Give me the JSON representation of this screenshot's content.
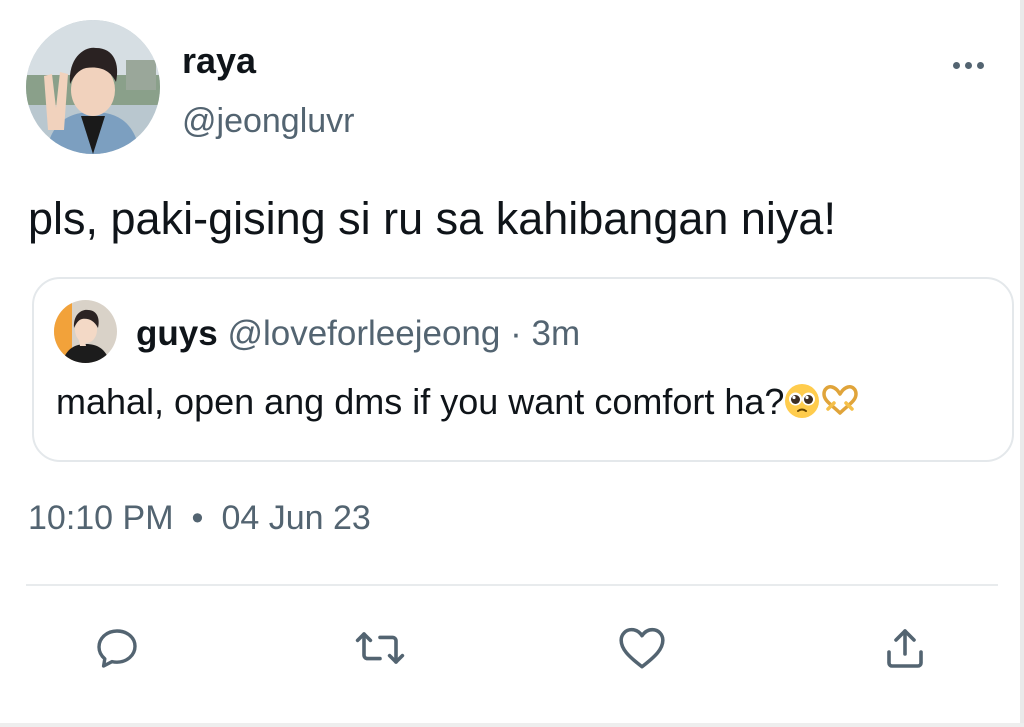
{
  "tweet": {
    "author": {
      "display_name": "raya",
      "handle": "@jeongluvr"
    },
    "text": "pls, paki-gising si ru sa kahibangan niya!",
    "timestamp": {
      "time": "10:10 PM",
      "separator": "•",
      "date": "04 Jun 23"
    },
    "quoted_tweet": {
      "display_name": "guys",
      "handle": "@loveforleejeong",
      "separator": "·",
      "time": "3m",
      "text": "mahal, open ang dms if you want comfort ha?",
      "emojis": [
        "pleading-face-emoji",
        "heart-hands-emoji"
      ]
    },
    "icons": {
      "more": "more-options-icon",
      "reply": "reply-icon",
      "retweet": "retweet-icon",
      "like": "heart-icon",
      "share": "share-icon"
    }
  },
  "colors": {
    "primary_text": "#0f1419",
    "secondary_text": "#536471",
    "border": "#e4e8eb",
    "background": "#ffffff"
  }
}
